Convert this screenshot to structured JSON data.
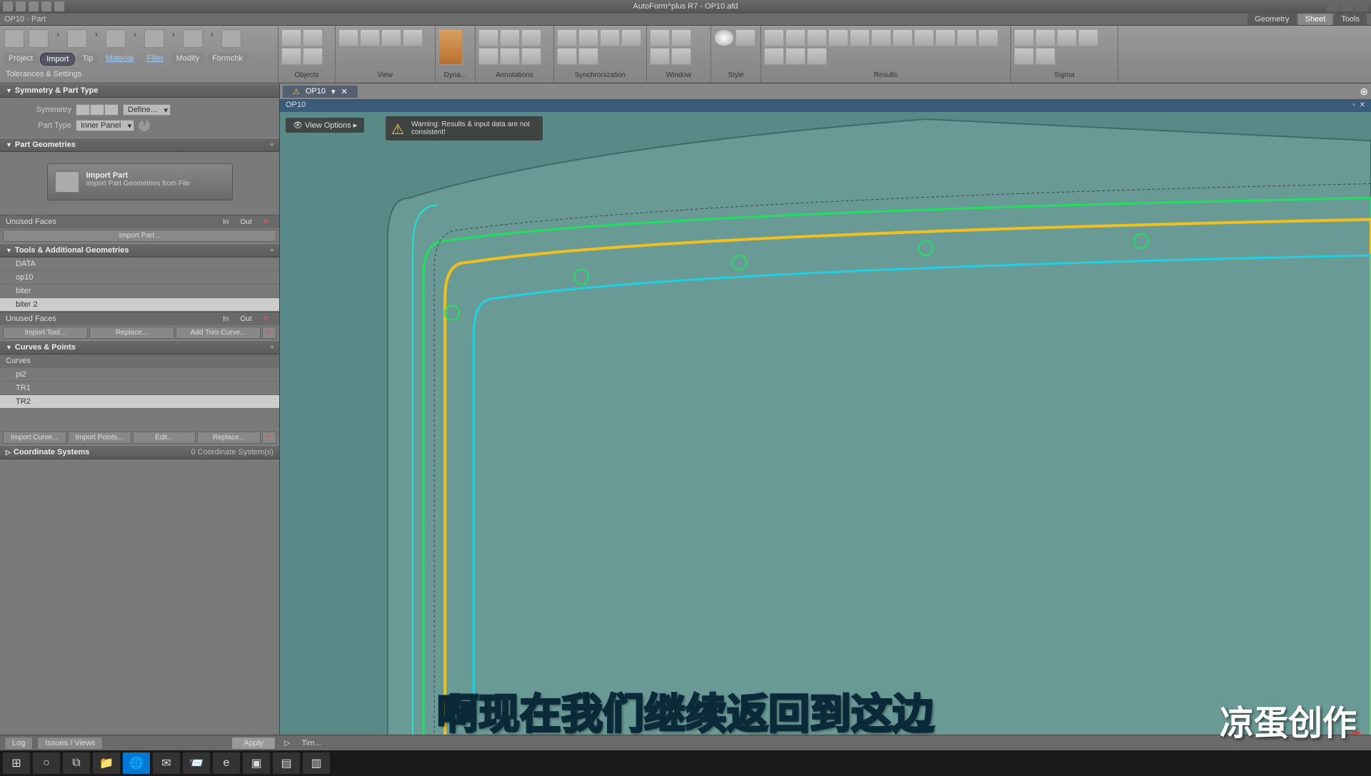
{
  "app": {
    "title": "AutoForm^plus R7 - OP10.afd",
    "subTitle": "OP10 - Part"
  },
  "topTabs": {
    "geometry": "Geometry",
    "sheet": "Sheet",
    "tools": "Tools",
    "active": "sheet"
  },
  "secondaryTabs": [
    "Project",
    "Import",
    "Tip",
    "Material",
    "Fillet",
    "Modify",
    "Formchk"
  ],
  "secondaryActive": "Import",
  "tolerances": "Tolerances & Settings",
  "ribbonGroups": [
    "Objects",
    "View",
    "Dyna...",
    "Annotations",
    "Synchronization",
    "Window",
    "Style",
    "Results",
    "Sigma"
  ],
  "sections": {
    "symmetry": {
      "title": "Symmetry & Part Type",
      "symLabel": "Symmetry",
      "defineBtn": "Define...",
      "partLabel": "Part Type",
      "partValue": "Inner Panel"
    },
    "partGeo": {
      "title": "Part Geometries",
      "importTitle": "Import Part",
      "importDesc": "Import Part Geometries from File"
    },
    "unusedFaces": "Unused Faces",
    "inBtn": "In",
    "outBtn": "Out",
    "importPartBtn": "Import Part...",
    "toolsGeo": {
      "title": "Tools & Additional Geometries",
      "items": [
        "DATA",
        "op10",
        "biter",
        "biter 2"
      ]
    },
    "toolBtns": [
      "Import Tool...",
      "Replace...",
      "Add Trim Curve..."
    ],
    "curvesPoints": {
      "title": "Curves & Points",
      "subTitle": "Curves",
      "items": [
        "pi2",
        "TR1",
        "TR2"
      ]
    },
    "curveBtns": [
      "Import Curve...",
      "Import Points...",
      "Edit...",
      "Replace..."
    ],
    "coordSys": {
      "title": "Coordinate Systems",
      "count": "0 Coordinate System(s)"
    }
  },
  "docTab": {
    "name": "OP10",
    "header": "OP10"
  },
  "viewOptions": "View Options",
  "warning": "Warning: Results & input data are not consistent!",
  "bottomBar": {
    "log": "Log",
    "issues": "Issues / Views",
    "apply": "Apply",
    "timeline": "Tim..."
  },
  "subtitle": "啊现在我们继续返回到这边",
  "watermark": "凉蛋创作",
  "taskbarIcons": [
    "⊞",
    "○",
    "⧉",
    "📁",
    "✉",
    "🌐",
    "📨",
    "e",
    "▣",
    "▤",
    "▥"
  ]
}
